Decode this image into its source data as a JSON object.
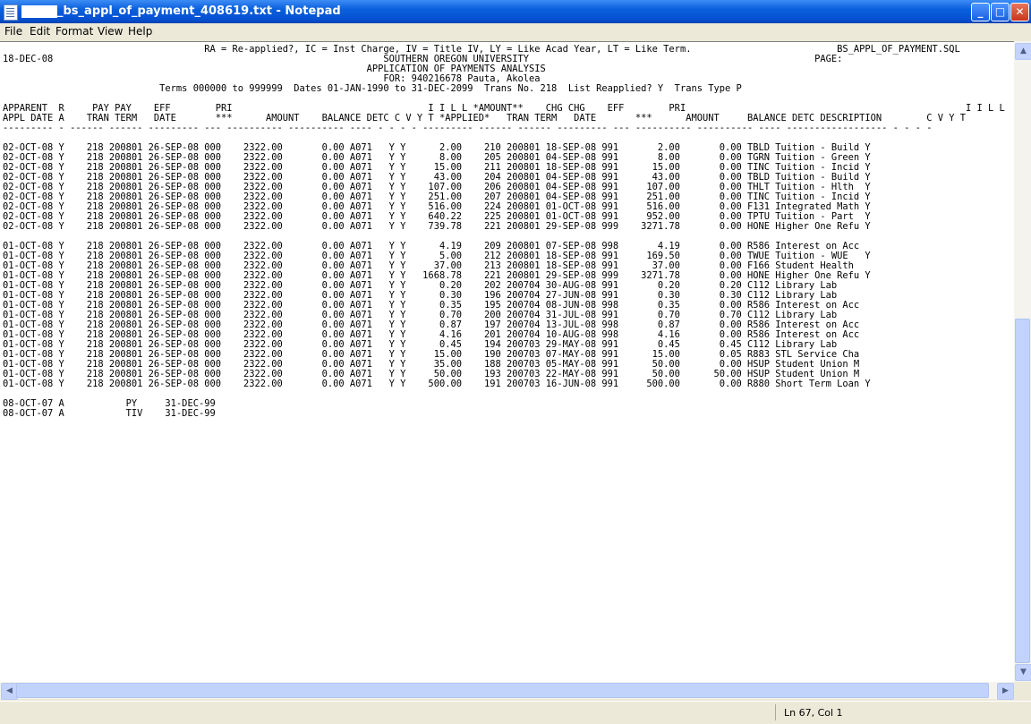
{
  "window": {
    "title": "_bs_appl_of_payment_408619.txt - Notepad"
  },
  "menu": {
    "file": "File",
    "edit": "Edit",
    "format": "Format",
    "view": "View",
    "help": "Help"
  },
  "document": {
    "text": "                                    RA = Re-applied?, IC = Inst Charge, IV = Title IV, LY = Like Acad Year, LT = Like Term.                          BS_APPL_OF_PAYMENT.SQL\n18-DEC-08                                                           SOUTHERN OREGON UNIVERSITY                                                   PAGE:\n                                                                 APPLICATION OF PAYMENTS ANALYSIS\n                                                                    FOR: 940216678 Pauta, Akolea\n                            Terms 000000 to 999999  Dates 01-JAN-1990 to 31-DEC-2099  Trans No. 218  List Reapplied? Y  Trans Type P\n\nAPPARENT  R     PAY PAY    EFF        PRI                                   I I L L *AMOUNT**    CHG CHG    EFF        PRI                                                  I I L L\nAPPL DATE A    TRAN TERM   DATE       ***      AMOUNT    BALANCE DETC C V Y T *APPLIED*   TRAN TERM   DATE       ***      AMOUNT     BALANCE DETC DESCRIPTION        C V Y T\n--------- - ------ ------ --------- --- ---------- ---------- ---- - - - - --------- ------ ------ --------- --- ---------- ---------- ---- ------------------ - - - -\n\n02-OCT-08 Y    218 200801 26-SEP-08 000    2322.00       0.00 A071   Y Y      2.00    210 200801 18-SEP-08 991       2.00       0.00 TBLD Tuition - Build Y\n02-OCT-08 Y    218 200801 26-SEP-08 000    2322.00       0.00 A071   Y Y      8.00    205 200801 04-SEP-08 991       8.00       0.00 TGRN Tuition - Green Y\n02-OCT-08 Y    218 200801 26-SEP-08 000    2322.00       0.00 A071   Y Y     15.00    211 200801 18-SEP-08 991      15.00       0.00 TINC Tuition - Incid Y\n02-OCT-08 Y    218 200801 26-SEP-08 000    2322.00       0.00 A071   Y Y     43.00    204 200801 04-SEP-08 991      43.00       0.00 TBLD Tuition - Build Y\n02-OCT-08 Y    218 200801 26-SEP-08 000    2322.00       0.00 A071   Y Y    107.00    206 200801 04-SEP-08 991     107.00       0.00 THLT Tuition - Hlth  Y\n02-OCT-08 Y    218 200801 26-SEP-08 000    2322.00       0.00 A071   Y Y    251.00    207 200801 04-SEP-08 991     251.00       0.00 TINC Tuition - Incid Y\n02-OCT-08 Y    218 200801 26-SEP-08 000    2322.00       0.00 A071   Y Y    516.00    224 200801 01-OCT-08 991     516.00       0.00 F131 Integrated Math Y\n02-OCT-08 Y    218 200801 26-SEP-08 000    2322.00       0.00 A071   Y Y    640.22    225 200801 01-OCT-08 991     952.00       0.00 TPTU Tuition - Part  Y\n02-OCT-08 Y    218 200801 26-SEP-08 000    2322.00       0.00 A071   Y Y    739.78    221 200801 29-SEP-08 999    3271.78       0.00 HONE Higher One Refu Y\n\n01-OCT-08 Y    218 200801 26-SEP-08 000    2322.00       0.00 A071   Y Y      4.19    209 200801 07-SEP-08 998       4.19       0.00 R586 Interest on Acc\n01-OCT-08 Y    218 200801 26-SEP-08 000    2322.00       0.00 A071   Y Y      5.00    212 200801 18-SEP-08 991     169.50       0.00 TWUE Tuition - WUE   Y\n01-OCT-08 Y    218 200801 26-SEP-08 000    2322.00       0.00 A071   Y Y     37.00    213 200801 18-SEP-08 991      37.00       0.00 F166 Student Health\n01-OCT-08 Y    218 200801 26-SEP-08 000    2322.00       0.00 A071   Y Y   1668.78    221 200801 29-SEP-08 999    3271.78       0.00 HONE Higher One Refu Y\n01-OCT-08 Y    218 200801 26-SEP-08 000    2322.00       0.00 A071   Y Y      0.20    202 200704 30-AUG-08 991       0.20       0.20 C112 Library Lab\n01-OCT-08 Y    218 200801 26-SEP-08 000    2322.00       0.00 A071   Y Y      0.30    196 200704 27-JUN-08 991       0.30       0.30 C112 Library Lab\n01-OCT-08 Y    218 200801 26-SEP-08 000    2322.00       0.00 A071   Y Y      0.35    195 200704 08-JUN-08 998       0.35       0.00 R586 Interest on Acc\n01-OCT-08 Y    218 200801 26-SEP-08 000    2322.00       0.00 A071   Y Y      0.70    200 200704 31-JUL-08 991       0.70       0.70 C112 Library Lab\n01-OCT-08 Y    218 200801 26-SEP-08 000    2322.00       0.00 A071   Y Y      0.87    197 200704 13-JUL-08 998       0.87       0.00 R586 Interest on Acc\n01-OCT-08 Y    218 200801 26-SEP-08 000    2322.00       0.00 A071   Y Y      4.16    201 200704 10-AUG-08 998       4.16       0.00 R586 Interest on Acc\n01-OCT-08 Y    218 200801 26-SEP-08 000    2322.00       0.00 A071   Y Y      0.45    194 200703 29-MAY-08 991       0.45       0.45 C112 Library Lab\n01-OCT-08 Y    218 200801 26-SEP-08 000    2322.00       0.00 A071   Y Y     15.00    190 200703 07-MAY-08 991      15.00       0.05 R883 STL Service Cha\n01-OCT-08 Y    218 200801 26-SEP-08 000    2322.00       0.00 A071   Y Y     35.00    188 200703 05-MAY-08 991      50.00       0.00 HSUP Student Union M\n01-OCT-08 Y    218 200801 26-SEP-08 000    2322.00       0.00 A071   Y Y     50.00    193 200703 22-MAY-08 991      50.00      50.00 HSUP Student Union M\n01-OCT-08 Y    218 200801 26-SEP-08 000    2322.00       0.00 A071   Y Y    500.00    191 200703 16-JUN-08 991     500.00       0.00 R880 Short Term Loan Y\n\n08-OCT-07 A           PY     31-DEC-99\n08-OCT-07 A           TIV    31-DEC-99\n\n\n\n\n\n\n\n\n\n\n\n\n\n\n\n\n\n\n\n\n\n\n\n\n\n\n\n\n                                    RA = Re-applied?, IC = Inst Charge, IV = Title IV, LY = Like Acad Year, LT = Like Term.                          BS_APPL_OF_PAYMENT.SQL"
  },
  "status": {
    "position": "Ln 67, Col 1"
  },
  "icons": {
    "minimize": "minimize-icon",
    "maximize": "maximize-icon",
    "close": "close-icon"
  }
}
